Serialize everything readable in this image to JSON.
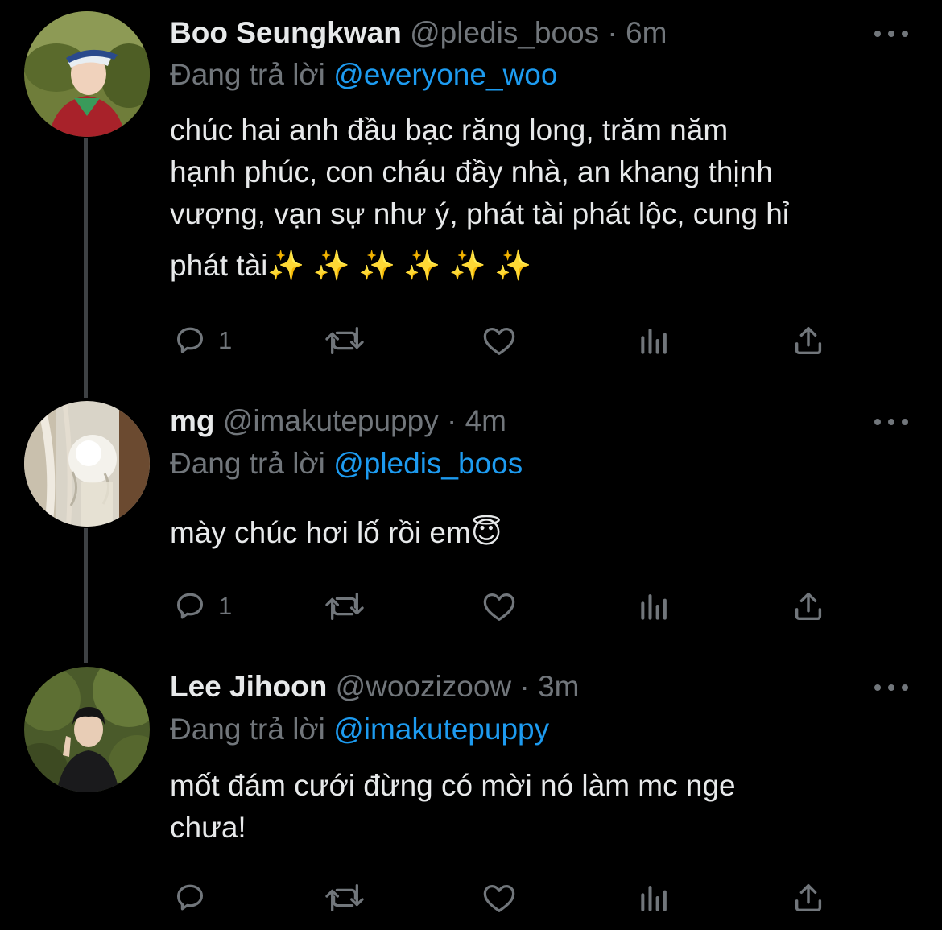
{
  "tweets": [
    {
      "display_name": "Boo Seungkwan",
      "handle": "@pledis_boos",
      "separator": "·",
      "time": "6m",
      "reply_label": "Đang trả lời",
      "reply_to": "@everyone_woo",
      "lines": [
        "chúc hai anh đầu bạc răng long, trăm năm",
        "hạnh phúc, con cháu đầy nhà, an khang thịnh",
        "vượng, vạn sự như ý, phát tài phát lộc, cung hỉ",
        "phát tài✨ ✨ ✨ ✨ ✨ ✨"
      ],
      "reply_count": "1",
      "avatar_icon": "avatar-person-red-jacket"
    },
    {
      "display_name": "mg",
      "handle": "@imakutepuppy",
      "separator": "·",
      "time": "4m",
      "reply_label": "Đang trả lời",
      "reply_to": "@pledis_boos",
      "lines": [
        "mày chúc hơi lố rồi em😇"
      ],
      "reply_count": "1",
      "avatar_icon": "avatar-white-rose"
    },
    {
      "display_name": "Lee Jihoon",
      "handle": "@woozizoow",
      "separator": "·",
      "time": "3m",
      "reply_label": "Đang trả lời",
      "reply_to": "@imakutepuppy",
      "lines": [
        "mốt đám cưới đừng có mời nó làm mc nge",
        "chưa!"
      ],
      "reply_count": "",
      "avatar_icon": "avatar-person-forest"
    }
  ],
  "icons": {
    "reply": "reply-icon",
    "retweet": "retweet-icon",
    "like": "like-icon",
    "views": "views-icon",
    "share": "share-icon",
    "more": "more-icon"
  },
  "colors": {
    "background": "#000000",
    "text": "#e7e9ea",
    "muted": "#71767b",
    "accent": "#1d9bf0",
    "thread_line": "#3e4144"
  }
}
